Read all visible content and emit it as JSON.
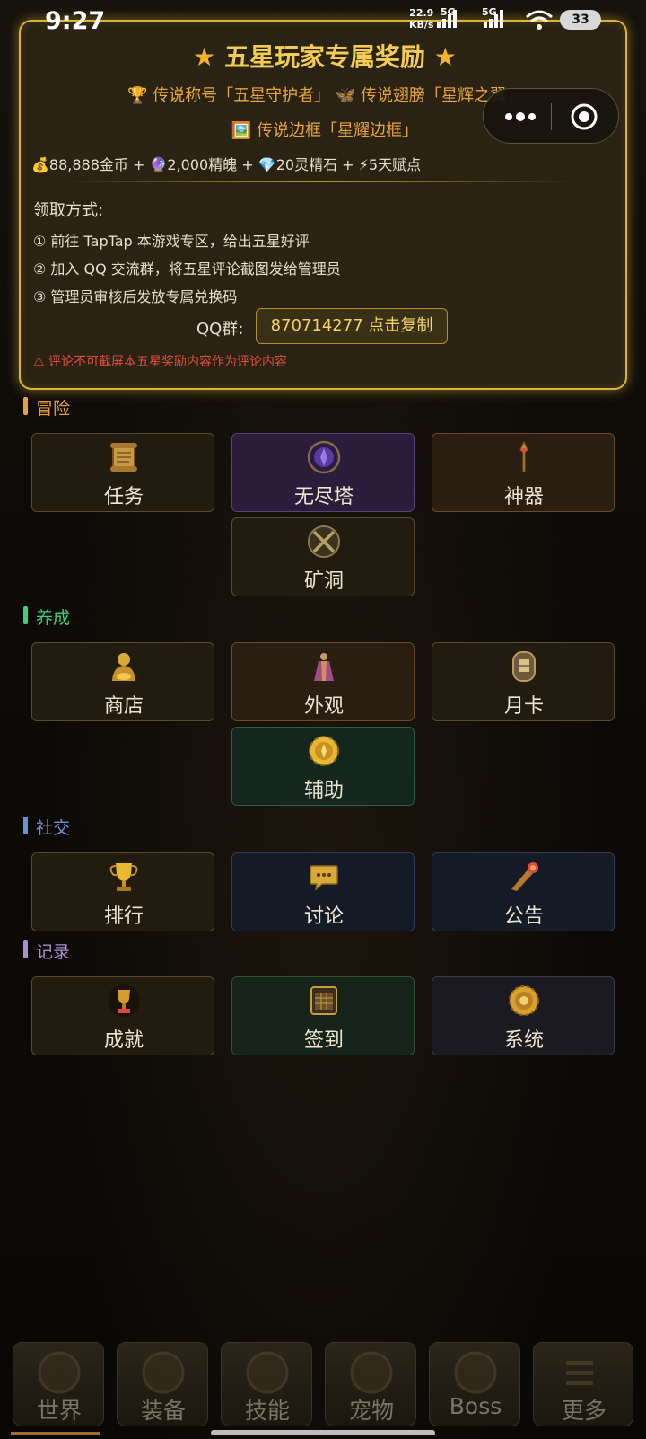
{
  "status_bar": {
    "time": "9:27",
    "net_speed_value": "22.9",
    "net_speed_unit": "KB/s",
    "sig1": "5G",
    "sig2": "5G",
    "battery": "33"
  },
  "banner": {
    "title": "五星玩家专属奖励",
    "star_left": "★",
    "star_right": "★",
    "reward_line1": "🏆 传说称号「五星守护者」 🦋 传说翅膀「星辉之翼」",
    "reward_line2": "🖼️ 传说边框「星耀边框」",
    "resources": "💰88,888金币 + 🔮2,000精魄 + 💎20灵精石 + ⚡5天赋点",
    "method_title": "领取方式:",
    "steps": [
      "① 前往 TapTap 本游戏专区，给出五星好评",
      "② 加入 QQ 交流群，将五星评论截图发给管理员",
      "③ 管理员审核后发放专属兑换码"
    ],
    "qq_label": "QQ群:",
    "qq_button": "870714277  点击复制",
    "warning": "⚠ 评论不可截屏本五星奖励内容作为评论内容"
  },
  "sections": {
    "adventure": {
      "title": "冒险",
      "color": "#e8a03a"
    },
    "growth": {
      "title": "养成",
      "color": "#3ecf7a"
    },
    "social": {
      "title": "社交",
      "color": "#6f8fd8"
    },
    "record": {
      "title": "记录",
      "color": "#a98fd0"
    }
  },
  "tiles": {
    "quest": "任务",
    "tower": "无尽塔",
    "artifact": "神器",
    "mine": "矿洞",
    "shop": "商店",
    "appearance": "外观",
    "monthcard": "月卡",
    "assist": "辅助",
    "rank": "排行",
    "discuss": "讨论",
    "notice": "公告",
    "achievement": "成就",
    "checkin": "签到",
    "system": "系统"
  },
  "bottom_nav": [
    "世界",
    "装备",
    "技能",
    "宠物",
    "Boss",
    "更多"
  ],
  "colors": {
    "gold": "#d8b43a",
    "accent_orange": "#e9a63c",
    "warning_red": "#e0503a"
  }
}
